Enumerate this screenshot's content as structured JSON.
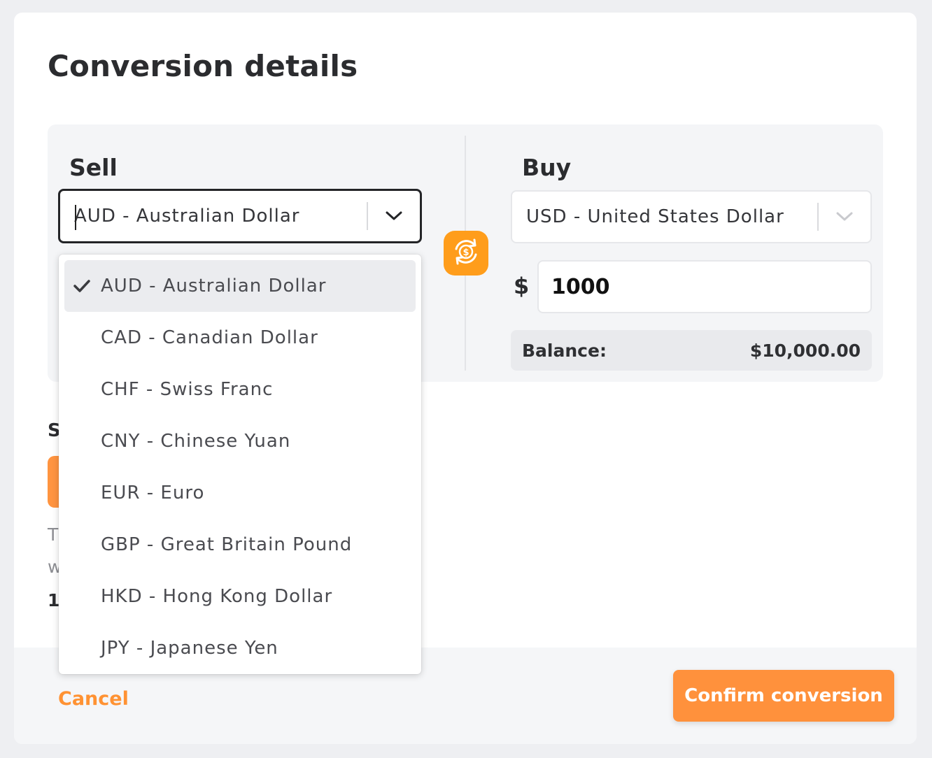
{
  "title": "Conversion details",
  "sell": {
    "label": "Sell",
    "selected": "AUD - Australian Dollar"
  },
  "buy": {
    "label": "Buy",
    "selected": "USD - United States Dollar",
    "currency_symbol": "$",
    "amount": "1000",
    "balance_label": "Balance:",
    "balance_value": "$10,000.00"
  },
  "obscured": {
    "s": "S",
    "t": "T",
    "w": "w",
    "num": "1."
  },
  "dropdown": {
    "options": [
      "AUD - Australian Dollar",
      "CAD - Canadian Dollar",
      "CHF - Swiss Franc",
      "CNY - Chinese Yuan",
      "EUR - Euro",
      "GBP - Great Britain Pound",
      "HKD - Hong Kong Dollar",
      "JPY - Japanese Yen"
    ],
    "selected_index": 0
  },
  "footer": {
    "cancel_label": "Cancel",
    "confirm_label": "Confirm conversion"
  },
  "colors": {
    "accent": "#ff913c",
    "swap_button": "#ff9d1b",
    "panel": "#f4f5f7"
  },
  "icons": {
    "swap": "currency-swap-icon",
    "chevron": "chevron-down-icon",
    "check": "checkmark-icon"
  }
}
